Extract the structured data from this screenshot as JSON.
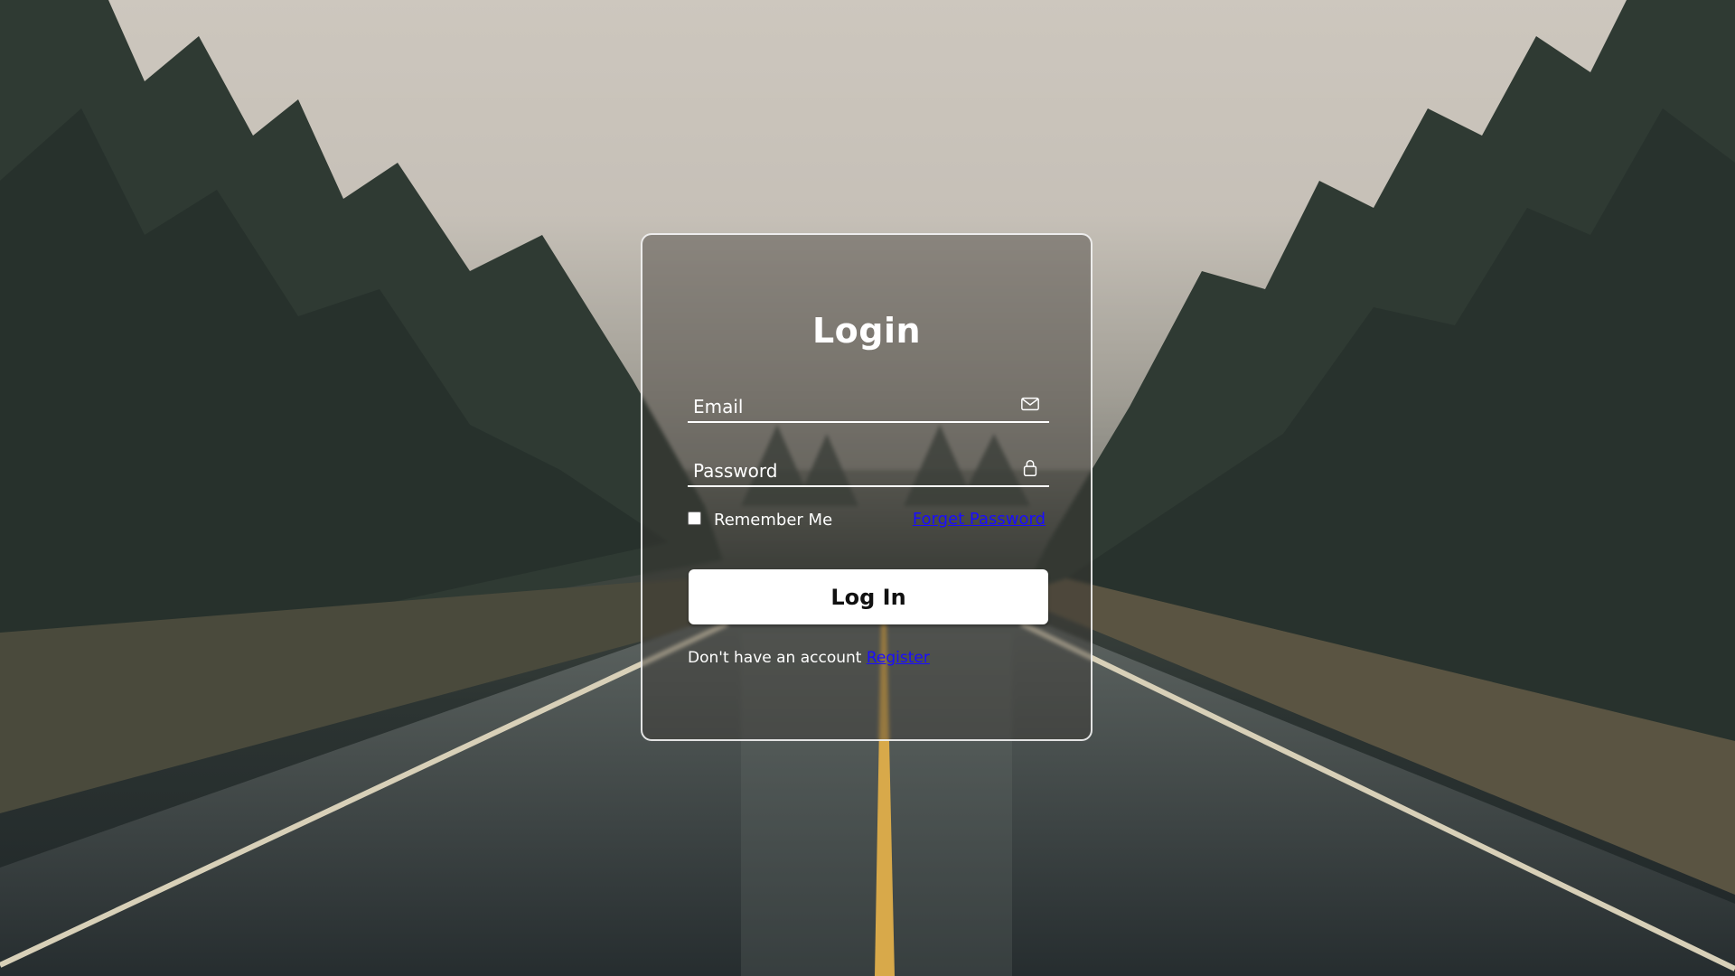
{
  "form": {
    "title": "Login",
    "email_label": "Email",
    "password_label": "Password",
    "remember_label": "Remember Me",
    "remember_checked": false,
    "forget_link": "Forget Password",
    "submit_label": "Log In",
    "register_prompt": "Don't have an account",
    "register_link": "Register"
  },
  "icons": {
    "email": "mail-icon",
    "password": "lock-icon"
  },
  "colors": {
    "link": "#1a0dff",
    "button_bg": "#ffffff",
    "button_text": "#111111",
    "card_border": "#ffffff"
  }
}
